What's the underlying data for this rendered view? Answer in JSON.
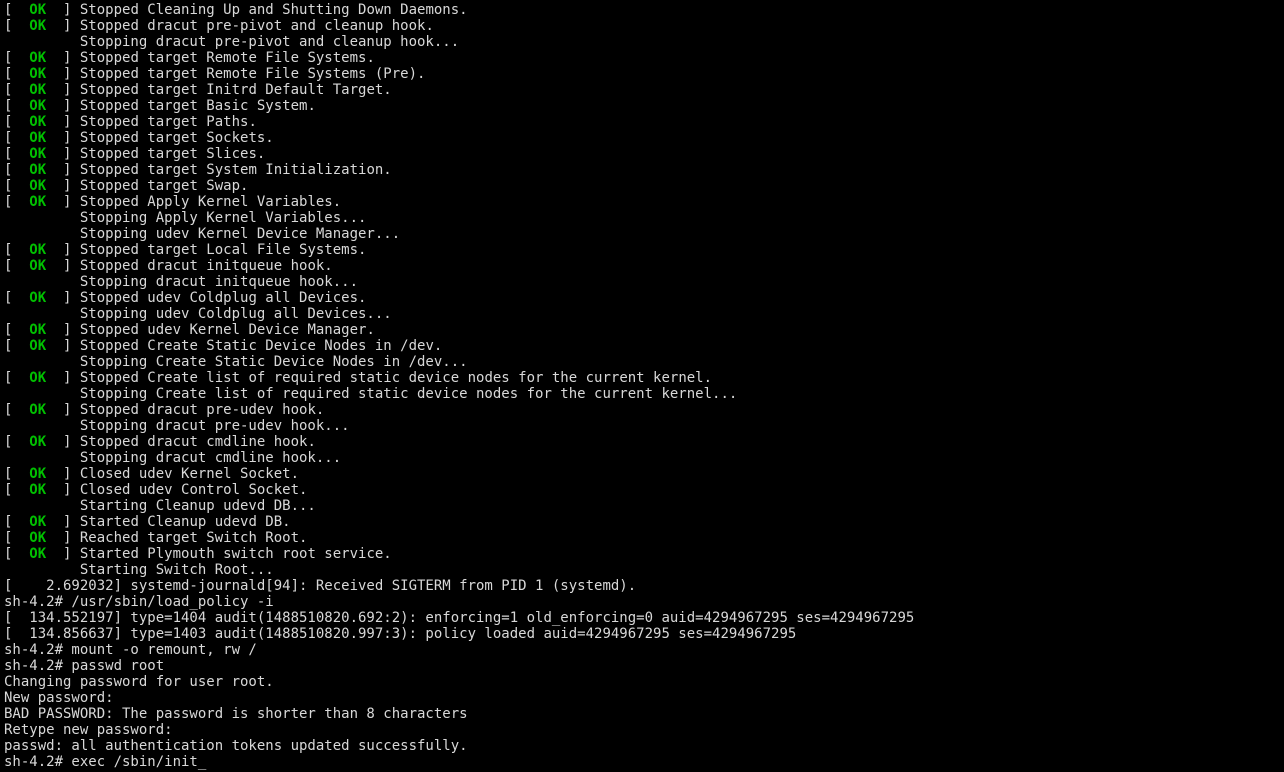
{
  "lines": [
    {
      "type": "ok",
      "text": "Stopped Cleaning Up and Shutting Down Daemons."
    },
    {
      "type": "ok",
      "text": "Stopped dracut pre-pivot and cleanup hook."
    },
    {
      "type": "plain",
      "text": "         Stopping dracut pre-pivot and cleanup hook..."
    },
    {
      "type": "ok",
      "text": "Stopped target Remote File Systems."
    },
    {
      "type": "ok",
      "text": "Stopped target Remote File Systems (Pre)."
    },
    {
      "type": "ok",
      "text": "Stopped target Initrd Default Target."
    },
    {
      "type": "ok",
      "text": "Stopped target Basic System."
    },
    {
      "type": "ok",
      "text": "Stopped target Paths."
    },
    {
      "type": "ok",
      "text": "Stopped target Sockets."
    },
    {
      "type": "ok",
      "text": "Stopped target Slices."
    },
    {
      "type": "ok",
      "text": "Stopped target System Initialization."
    },
    {
      "type": "ok",
      "text": "Stopped target Swap."
    },
    {
      "type": "ok",
      "text": "Stopped Apply Kernel Variables."
    },
    {
      "type": "plain",
      "text": "         Stopping Apply Kernel Variables..."
    },
    {
      "type": "plain",
      "text": "         Stopping udev Kernel Device Manager..."
    },
    {
      "type": "ok",
      "text": "Stopped target Local File Systems."
    },
    {
      "type": "ok",
      "text": "Stopped dracut initqueue hook."
    },
    {
      "type": "plain",
      "text": "         Stopping dracut initqueue hook..."
    },
    {
      "type": "ok",
      "text": "Stopped udev Coldplug all Devices."
    },
    {
      "type": "plain",
      "text": "         Stopping udev Coldplug all Devices..."
    },
    {
      "type": "ok",
      "text": "Stopped udev Kernel Device Manager."
    },
    {
      "type": "ok",
      "text": "Stopped Create Static Device Nodes in /dev."
    },
    {
      "type": "plain",
      "text": "         Stopping Create Static Device Nodes in /dev..."
    },
    {
      "type": "ok",
      "text": "Stopped Create list of required static device nodes for the current kernel."
    },
    {
      "type": "plain",
      "text": "         Stopping Create list of required static device nodes for the current kernel..."
    },
    {
      "type": "ok",
      "text": "Stopped dracut pre-udev hook."
    },
    {
      "type": "plain",
      "text": "         Stopping dracut pre-udev hook..."
    },
    {
      "type": "ok",
      "text": "Stopped dracut cmdline hook."
    },
    {
      "type": "plain",
      "text": "         Stopping dracut cmdline hook..."
    },
    {
      "type": "ok",
      "text": "Closed udev Kernel Socket."
    },
    {
      "type": "ok",
      "text": "Closed udev Control Socket."
    },
    {
      "type": "plain",
      "text": "         Starting Cleanup udevd DB..."
    },
    {
      "type": "ok",
      "text": "Started Cleanup udevd DB."
    },
    {
      "type": "ok",
      "text": "Reached target Switch Root."
    },
    {
      "type": "ok",
      "text": "Started Plymouth switch root service."
    },
    {
      "type": "plain",
      "text": "         Starting Switch Root..."
    },
    {
      "type": "plain",
      "text": "[    2.692032] systemd-journald[94]: Received SIGTERM from PID 1 (systemd)."
    },
    {
      "type": "plain",
      "text": "sh-4.2# /usr/sbin/load_policy -i"
    },
    {
      "type": "plain",
      "text": "[  134.552197] type=1404 audit(1488510820.692:2): enforcing=1 old_enforcing=0 auid=4294967295 ses=4294967295"
    },
    {
      "type": "plain",
      "text": "[  134.856637] type=1403 audit(1488510820.997:3): policy loaded auid=4294967295 ses=4294967295"
    },
    {
      "type": "plain",
      "text": "sh-4.2# mount -o remount, rw /"
    },
    {
      "type": "plain",
      "text": "sh-4.2# passwd root"
    },
    {
      "type": "plain",
      "text": "Changing password for user root."
    },
    {
      "type": "plain",
      "text": "New password:"
    },
    {
      "type": "plain",
      "text": "BAD PASSWORD: The password is shorter than 8 characters"
    },
    {
      "type": "plain",
      "text": "Retype new password:"
    },
    {
      "type": "plain",
      "text": "passwd: all authentication tokens updated successfully."
    },
    {
      "type": "plain",
      "text": "sh-4.2# exec /sbin/init_"
    }
  ],
  "status_label": "OK"
}
